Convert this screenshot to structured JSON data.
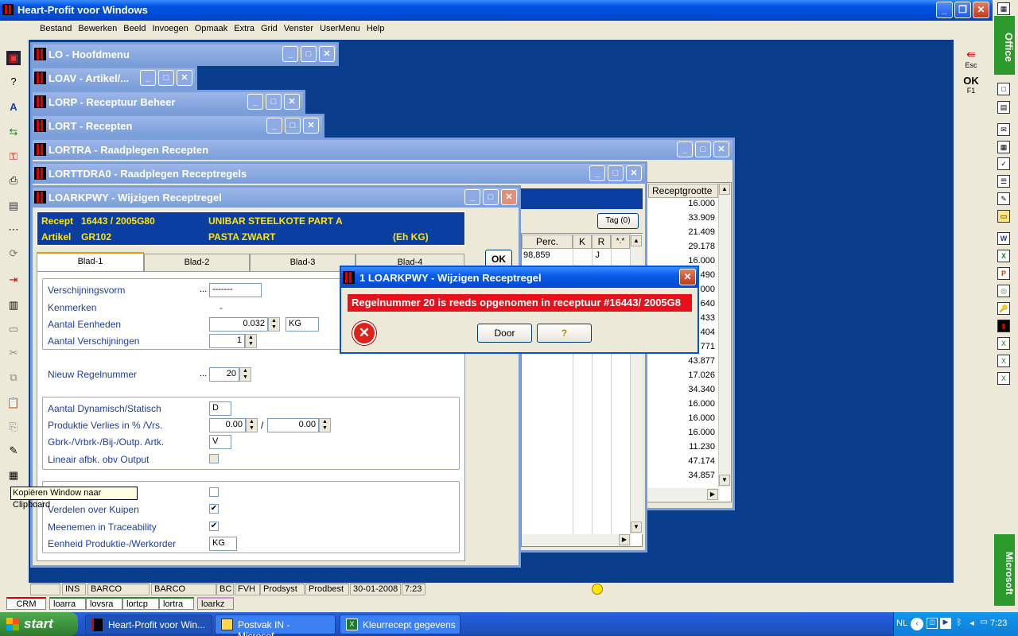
{
  "app": {
    "title": "Heart-Profit voor Windows"
  },
  "menu": [
    "Bestand",
    "Bewerken",
    "Beeld",
    "Invoegen",
    "Opmaak",
    "Extra",
    "Grid",
    "Venster",
    "UserMenu",
    "Help"
  ],
  "windows": {
    "w1": "LO - Hoofdmenu",
    "w2": "LOAV - Artikel/...",
    "w3": "LORP - Receptuur Beheer",
    "w4": "LORT - Recepten",
    "w5": "LORTRA - Raadplegen Recepten",
    "w6": "LORTTDRA0 - Raadplegen Receptregels",
    "w7": "LOARKPWY - Wijzigen Receptregel"
  },
  "receptregel": {
    "recept_label": "Recept",
    "recept_value": "16443 / 2005G80",
    "recept_name": "UNIBAR STEELKOTE PART A",
    "artikel_label": "Artikel",
    "artikel_value": "GR102",
    "artikel_name": "PASTA ZWART",
    "unit": "(Eh KG)",
    "tabs": [
      "Blad-1",
      "Blad-2",
      "Blad-3",
      "Blad-4"
    ],
    "ok_label": "OK",
    "f_verschijningsvorm": "Verschijningsvorm",
    "v_verschijningsvorm": "-------",
    "dots": "...",
    "f_kenmerken": "Kenmerken",
    "v_kenmerken": "-",
    "f_aantal_eenheden": "Aantal Eenheden",
    "v_aantal_eenheden": "0.032",
    "v_eenheid": "KG",
    "f_aantal_verschijningen": "Aantal Verschijningen",
    "v_aantal_verschijningen": "1",
    "f_nieuw_regelnummer": "Nieuw Regelnummer",
    "v_nieuw_regelnummer": "20",
    "f_dyn_stat": "Aantal Dynamisch/Statisch",
    "v_dyn_stat": "D",
    "f_prod_verlies": "Produktie Verlies in % /Vrs.",
    "v_prod_verlies_1": "0.00",
    "slash": "/",
    "v_prod_verlies_2": "0.00",
    "f_gbrk": "Gbrk-/Vrbrk-/Bij-/Outp. Artk.",
    "v_gbrk": "V",
    "f_lineair": "Lineair afbk. obv Output",
    "f_verdelen": "Verdelen over Kuipen",
    "f_meenemen": "Meenemen in Traceability",
    "f_eenheid_prod": "Eenheid Produktie-/Werkorder",
    "v_eenheid_prod": "KG"
  },
  "receptregels_grid": {
    "tag_button": "Tag (0)",
    "headers": [
      "Perc.",
      "K",
      "R",
      "*.*"
    ],
    "row": {
      "perc": "98,859",
      "r": "J"
    }
  },
  "recepten_grid": {
    "header": "Receptgrootte",
    "values": [
      "16.000",
      "33.909",
      "21.409",
      "29.178",
      "16.000",
      "490",
      "000",
      "640",
      "433",
      "404",
      "771",
      "43.877",
      "17.026",
      "34.340",
      "16.000",
      "16.000",
      "16.000",
      "11.230",
      "47.174",
      "34.857"
    ]
  },
  "dialog": {
    "title": "1 LOARKPWY - Wijzigen Receptregel",
    "message": "Regelnummer 20 is reeds opgenomen in receptuur #16443/ 2005G8",
    "door": "Door",
    "help": "?"
  },
  "tooltip": "Kopiëren Window naar Clipboard",
  "right_panel": {
    "esc": "Esc",
    "ok": "OK",
    "f1": "F1"
  },
  "office": {
    "top": "Office",
    "bottom": "Microsoft"
  },
  "statusbar": [
    "INS",
    "BARCO",
    "BARCO",
    "BC",
    "FVH",
    "Prodsyst",
    "Prodbest",
    "30-01-2008",
    "7:23"
  ],
  "program_tabs": [
    "CRM",
    "loarra",
    "lovsra",
    "lortcp",
    "lortra",
    "loarkz"
  ],
  "taskbar": {
    "start": "start",
    "items": [
      "Heart-Profit voor Win...",
      "Postvak IN - Microsof...",
      "Kleurrecept gegevens"
    ],
    "lang": "NL",
    "time": "7:23"
  }
}
